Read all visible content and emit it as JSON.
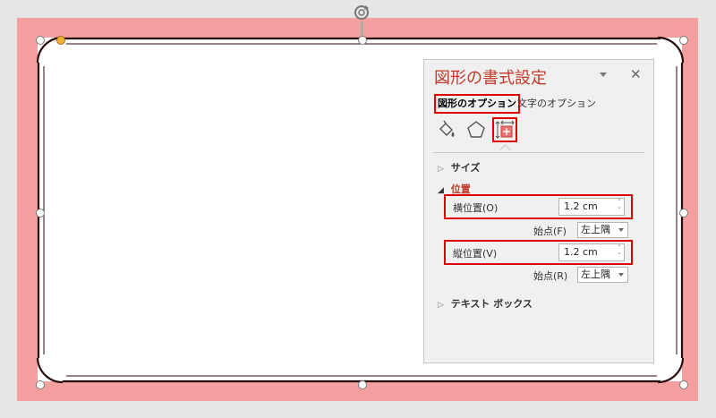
{
  "pane": {
    "title": "図形の書式設定",
    "close_glyph": "✕",
    "tabs": {
      "shape_options": "図形のオプション",
      "text_options": "文字のオプション"
    },
    "icons": [
      "fill-line-icon",
      "effects-pentagon-icon",
      "size-properties-icon"
    ],
    "sections": {
      "size": {
        "arrow": "▷",
        "label": "サイズ"
      },
      "position": {
        "arrow": "◢",
        "label": "位置",
        "horizontal": {
          "label": "横位置(O)",
          "value": "1.2 cm",
          "origin_label": "始点(F)",
          "origin_value": "左上隅"
        },
        "vertical": {
          "label": "縦位置(V)",
          "value": "1.2 cm",
          "origin_label": "始点(R)",
          "origin_value": "左上隅"
        }
      },
      "textbox": {
        "arrow": "▷",
        "label": "テキスト ボックス"
      }
    }
  },
  "colors": {
    "shape_fill": "#f4a0a0",
    "frame_line": "#2a0a0a",
    "highlight": "#e00000",
    "accent": "#c0392b"
  }
}
